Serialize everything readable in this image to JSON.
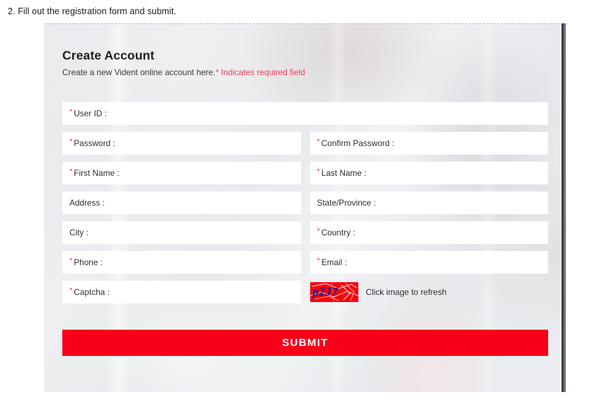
{
  "instruction": "2. Fill out the registration form and submit.",
  "form": {
    "heading": "Create Account",
    "subheading_text": "Create a new Vident online account here.",
    "required_note": "* Indicates required field",
    "required_marker": "*",
    "rows": [
      {
        "layout": "full",
        "fields": [
          {
            "label": "User ID :",
            "required": true,
            "value": "",
            "placeholder": ""
          }
        ]
      },
      {
        "layout": "half",
        "fields": [
          {
            "label": "Password :",
            "required": true,
            "value": "",
            "placeholder": ""
          },
          {
            "label": "Confirm Password :",
            "required": true,
            "value": "",
            "placeholder": ""
          }
        ]
      },
      {
        "layout": "half",
        "fields": [
          {
            "label": "First Name :",
            "required": true,
            "value": "",
            "placeholder": ""
          },
          {
            "label": "Last Name :",
            "required": true,
            "value": "",
            "placeholder": ""
          }
        ]
      },
      {
        "layout": "half",
        "fields": [
          {
            "label": "Address :",
            "required": false,
            "value": "",
            "placeholder": ""
          },
          {
            "label": "State/Province :",
            "required": false,
            "value": "",
            "placeholder": ""
          }
        ]
      },
      {
        "layout": "half",
        "fields": [
          {
            "label": "City :",
            "required": false,
            "value": "",
            "placeholder": ""
          },
          {
            "label": "Country :",
            "required": true,
            "value": "",
            "placeholder": ""
          }
        ]
      },
      {
        "layout": "half",
        "fields": [
          {
            "label": "Phone :",
            "required": true,
            "value": "",
            "placeholder": ""
          },
          {
            "label": "Email :",
            "required": true,
            "value": "",
            "placeholder": ""
          }
        ]
      }
    ],
    "captcha": {
      "label": "Captcha :",
      "required": true,
      "value": "",
      "image_text": "p2J7",
      "refresh_hint": "Click image to refresh"
    },
    "submit_label": "SUBMIT"
  },
  "colors": {
    "accent_red": "#f80019",
    "required_red": "#ee3b52",
    "note_red": "#ec4158",
    "captcha_bg": "#f6060b",
    "captcha_fg": "#2c1f8c",
    "field_bg": "#ffffff",
    "page_bg": "#eceef0",
    "heading_text": "#231f20"
  }
}
